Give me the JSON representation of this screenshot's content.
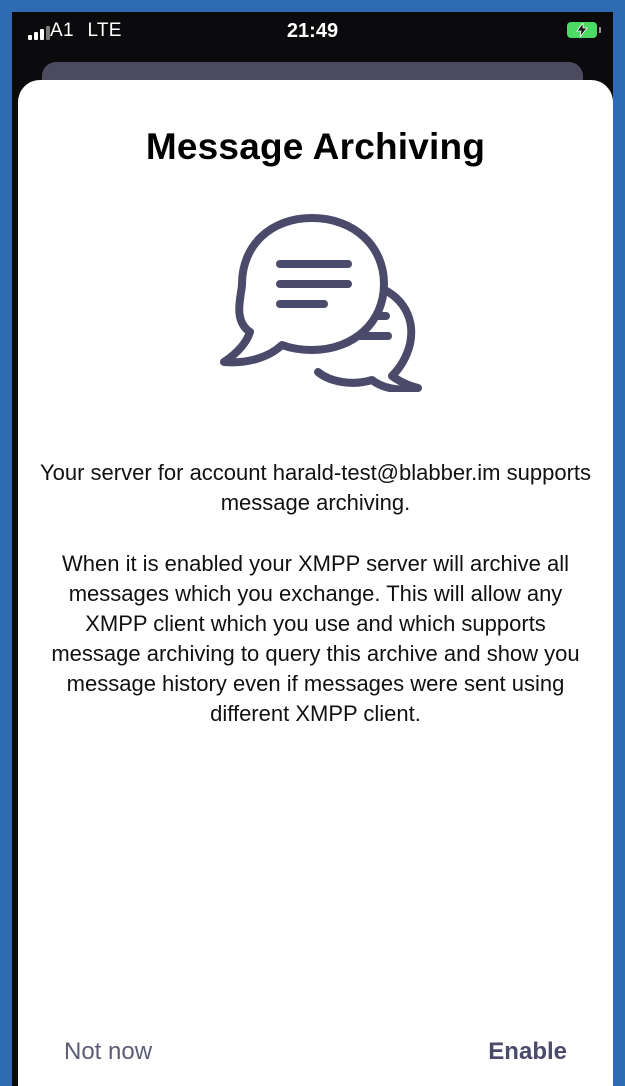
{
  "status_bar": {
    "carrier": "A1",
    "network": "LTE",
    "time": "21:49",
    "battery_color": "#4cd964"
  },
  "dialog": {
    "title": "Message Archiving",
    "icon": "chat-bubbles-icon",
    "accent_color": "#4b4a6b",
    "paragraph_1": "Your server for account harald-test@blabber.im supports message archiving.",
    "paragraph_2": "When it is enabled your XMPP server will archive all messages which you exchange. This will allow any XMPP client which you use and which supports message archiving to query this archive and show you message history even if messages were sent using different XMPP client.",
    "buttons": {
      "not_now": "Not now",
      "enable": "Enable"
    }
  }
}
